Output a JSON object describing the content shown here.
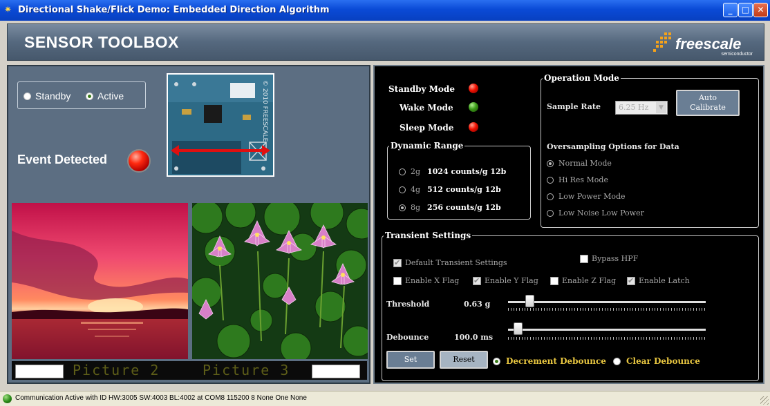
{
  "window": {
    "title": "Directional Shake/Flick Demo: Embedded Direction Algorithm",
    "minimize": "_",
    "maximize": "□",
    "close": "✕"
  },
  "banner": {
    "brand": "SENSOR TOOLBOX",
    "logo_name": "freescale",
    "logo_sub": "semiconductor"
  },
  "left": {
    "modes": [
      {
        "label": "Standby",
        "selected": false
      },
      {
        "label": "Active",
        "selected": true
      }
    ],
    "event_label": "Event Detected",
    "event_led_color": "#ff2a10",
    "board_text": "© 2010 FREESCALE",
    "picture_labels": [
      "Picture 2",
      "Picture 3"
    ]
  },
  "status_leds": [
    {
      "label": "Standby Mode",
      "color": "red"
    },
    {
      "label": "Wake Mode",
      "color": "green"
    },
    {
      "label": "Sleep Mode",
      "color": "red"
    }
  ],
  "dynamic_range": {
    "legend": "Dynamic Range",
    "options": [
      {
        "g": "2g",
        "detail": "1024 counts/g 12b",
        "selected": false
      },
      {
        "g": "4g",
        "detail": "512 counts/g 12b",
        "selected": false
      },
      {
        "g": "8g",
        "detail": "256 counts/g 12b",
        "selected": true
      }
    ]
  },
  "operation_mode": {
    "legend": "Operation Mode",
    "sample_rate_label": "Sample Rate",
    "sample_rate_value": "6.25 Hz",
    "auto_calibrate_line1": "Auto",
    "auto_calibrate_line2": "Calibrate",
    "oversampling_label": "Oversampling Options for Data",
    "oversampling_options": [
      {
        "label": "Normal Mode",
        "selected": true
      },
      {
        "label": "Hi Res Mode",
        "selected": false
      },
      {
        "label": "Low Power Mode",
        "selected": false
      },
      {
        "label": "Low Noise Low Power",
        "selected": false
      }
    ]
  },
  "transient": {
    "legend": "Transient Settings",
    "default_settings": {
      "label": "Default Transient Settings",
      "checked": true
    },
    "bypass_hpf": {
      "label": "Bypass HPF",
      "checked": false
    },
    "flags": [
      {
        "label": "Enable X Flag",
        "checked": false
      },
      {
        "label": "Enable Y Flag",
        "checked": true
      },
      {
        "label": "Enable Z Flag",
        "checked": false
      },
      {
        "label": "Enable Latch",
        "checked": true
      }
    ],
    "threshold_label": "Threshold",
    "threshold_value": "0.63 g",
    "threshold_fraction": 0.09,
    "debounce_label": "Debounce",
    "debounce_value": "100.0 ms",
    "debounce_fraction": 0.03,
    "set_label": "Set",
    "reset_label": "Reset",
    "debounce_modes": [
      {
        "label": "Decrement Debounce",
        "selected": true
      },
      {
        "label": "Clear Debounce",
        "selected": false
      }
    ]
  },
  "statusbar": {
    "text": "Communication Active with ID HW:3005 SW:4003 BL:4002 at COM8 115200 8 None One None"
  }
}
